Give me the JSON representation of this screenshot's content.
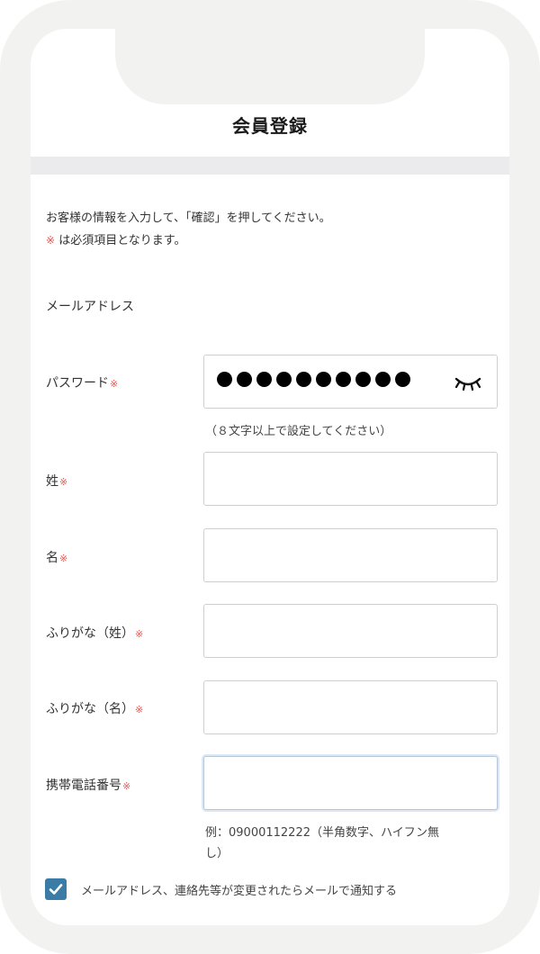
{
  "header": {
    "title": "会員登録"
  },
  "intro": {
    "line1": "お客様の情報を入力して、「確認」を押してください。",
    "required_mark": "※",
    "line2_rest": " は必須項目となります。"
  },
  "form": {
    "email": {
      "label": "メールアドレス"
    },
    "password": {
      "label": "パスワード",
      "masked_length": 10,
      "hint": "（８文字以上で設定してください）"
    },
    "last_name": {
      "label": "姓"
    },
    "first_name": {
      "label": "名"
    },
    "last_name_kana": {
      "label": "ふりがな（姓）"
    },
    "first_name_kana": {
      "label": "ふりがな（名）"
    },
    "phone": {
      "label": "携帯電話番号",
      "hint_line1": "例：09000112222（半角数字、ハイフン無",
      "hint_line2": "し）"
    },
    "required_mark": "※"
  },
  "notify": {
    "checked": true,
    "label": "メールアドレス、連絡先等が変更されたらメールで通知する"
  },
  "icons": {
    "password_toggle": "eye-closed-icon",
    "checkbox": "check-icon"
  },
  "colors": {
    "required": "#e8554e",
    "checkbox": "#3b7ca6"
  }
}
